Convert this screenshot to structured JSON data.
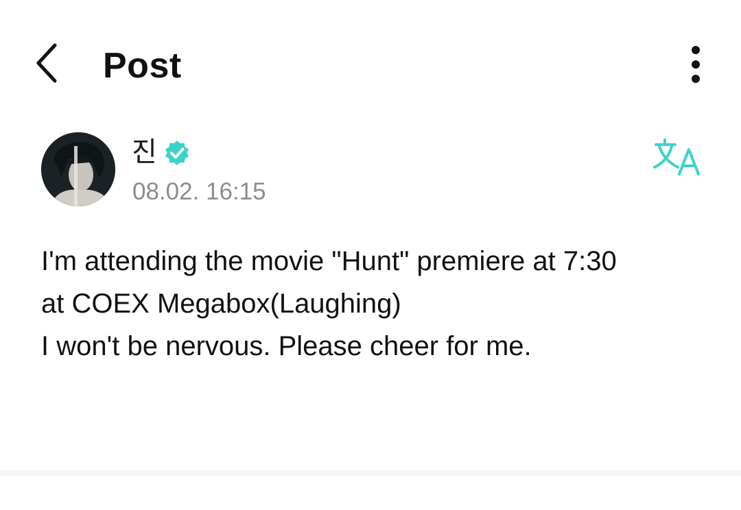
{
  "header": {
    "title": "Post",
    "back_icon": "chevron-left-icon",
    "more_icon": "more-vertical-icon"
  },
  "post": {
    "author": {
      "name": "진",
      "verified_icon": "verified-badge-icon",
      "verified_color": "#3dd2c9"
    },
    "timestamp": "08.02. 16:15",
    "translate_icon": "translate-icon",
    "accent_color": "#3dd2c9",
    "body_lines": [
      "I'm attending the movie \"Hunt\" premiere at 7:30",
      "at COEX Megabox(Laughing)",
      "I won't be nervous. Please cheer for me."
    ]
  }
}
